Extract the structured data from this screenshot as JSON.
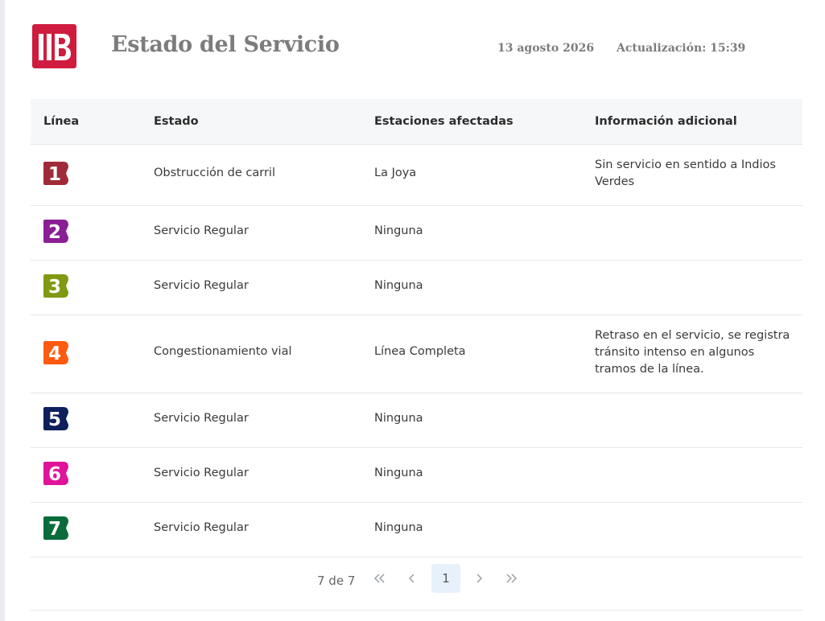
{
  "header": {
    "title": "Estado del Servicio",
    "date": "13 agosto 2026",
    "update": "Actualización: 15:39",
    "logo_color": "#cf1c3e"
  },
  "table": {
    "columns": [
      "Línea",
      "Estado",
      "Estaciones afectadas",
      "Información adicional"
    ],
    "rows": [
      {
        "line": "1",
        "color": "#9f2b38",
        "status": "Obstrucción de carril",
        "stations": "La Joya",
        "info": "Sin servicio en sentido a Indios Verdes"
      },
      {
        "line": "2",
        "color": "#8a1f95",
        "status": "Servicio Regular",
        "stations": "Ninguna",
        "info": ""
      },
      {
        "line": "3",
        "color": "#7f9a12",
        "status": "Servicio Regular",
        "stations": "Ninguna",
        "info": ""
      },
      {
        "line": "4",
        "color": "#ff5a0f",
        "status": "Congestionamiento vial",
        "stations": "Línea Completa",
        "info": "Retraso en el servicio, se registra tránsito intenso en algunos tramos de la línea."
      },
      {
        "line": "5",
        "color": "#0e1f5b",
        "status": "Servicio Regular",
        "stations": "Ninguna",
        "info": ""
      },
      {
        "line": "6",
        "color": "#e0139a",
        "status": "Servicio Regular",
        "stations": "Ninguna",
        "info": ""
      },
      {
        "line": "7",
        "color": "#0b6b3a",
        "status": "Servicio Regular",
        "stations": "Ninguna",
        "info": ""
      }
    ]
  },
  "pagination": {
    "count": "7 de 7",
    "first_icon": "double-chevron-left-icon",
    "prev_icon": "chevron-left-icon",
    "current": "1",
    "next_icon": "chevron-right-icon",
    "last_icon": "double-chevron-right-icon"
  }
}
